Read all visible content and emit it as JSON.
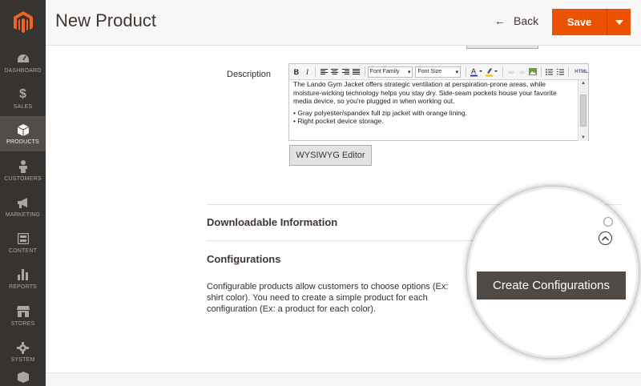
{
  "sidebar": {
    "items": [
      {
        "label": "DASHBOARD",
        "icon": "dashboard-icon"
      },
      {
        "label": "SALES",
        "icon": "dollar-icon"
      },
      {
        "label": "PRODUCTS",
        "icon": "cube-icon",
        "active": true
      },
      {
        "label": "CUSTOMERS",
        "icon": "person-icon"
      },
      {
        "label": "MARKETING",
        "icon": "megaphone-icon"
      },
      {
        "label": "CONTENT",
        "icon": "content-icon"
      },
      {
        "label": "REPORTS",
        "icon": "bar-chart-icon"
      },
      {
        "label": "STORES",
        "icon": "store-icon"
      },
      {
        "label": "SYSTEM",
        "icon": "gear-icon"
      }
    ]
  },
  "header": {
    "title": "New Product",
    "back_label": "Back",
    "save_label": "Save"
  },
  "description": {
    "label": "Description",
    "toolbar": {
      "bold": "B",
      "italic": "I",
      "font_family": "Font Family",
      "font_size": "Font Size",
      "html": "HTML"
    },
    "paragraph": "The Lando Gym Jacket offers strategic ventilation at perspiration-prone areas, while moisture-wicking technology helps you stay dry. Side-seam pockets house your favorite media device, so you're plugged in when working out.",
    "bullet_1": "• Gray polyester/spandex full zip jacket with orange lining.",
    "bullet_2": "• Right pocket device storage.",
    "editor_toggle_label": "WYSIWYG Editor"
  },
  "sections": {
    "downloadable_title": "Downloadable Information",
    "configurations_title": "Configurations",
    "configurations_text": "Configurable products allow customers to choose options (Ex: shirt color). You need to create a simple product for each configuration (Ex: a product for each color).",
    "create_configurations_label": "Create Configurations"
  },
  "colors": {
    "sidebar_bg": "#373330",
    "sidebar_active": "#524d49",
    "accent": "#eb5202",
    "primary_button": "#514943"
  }
}
